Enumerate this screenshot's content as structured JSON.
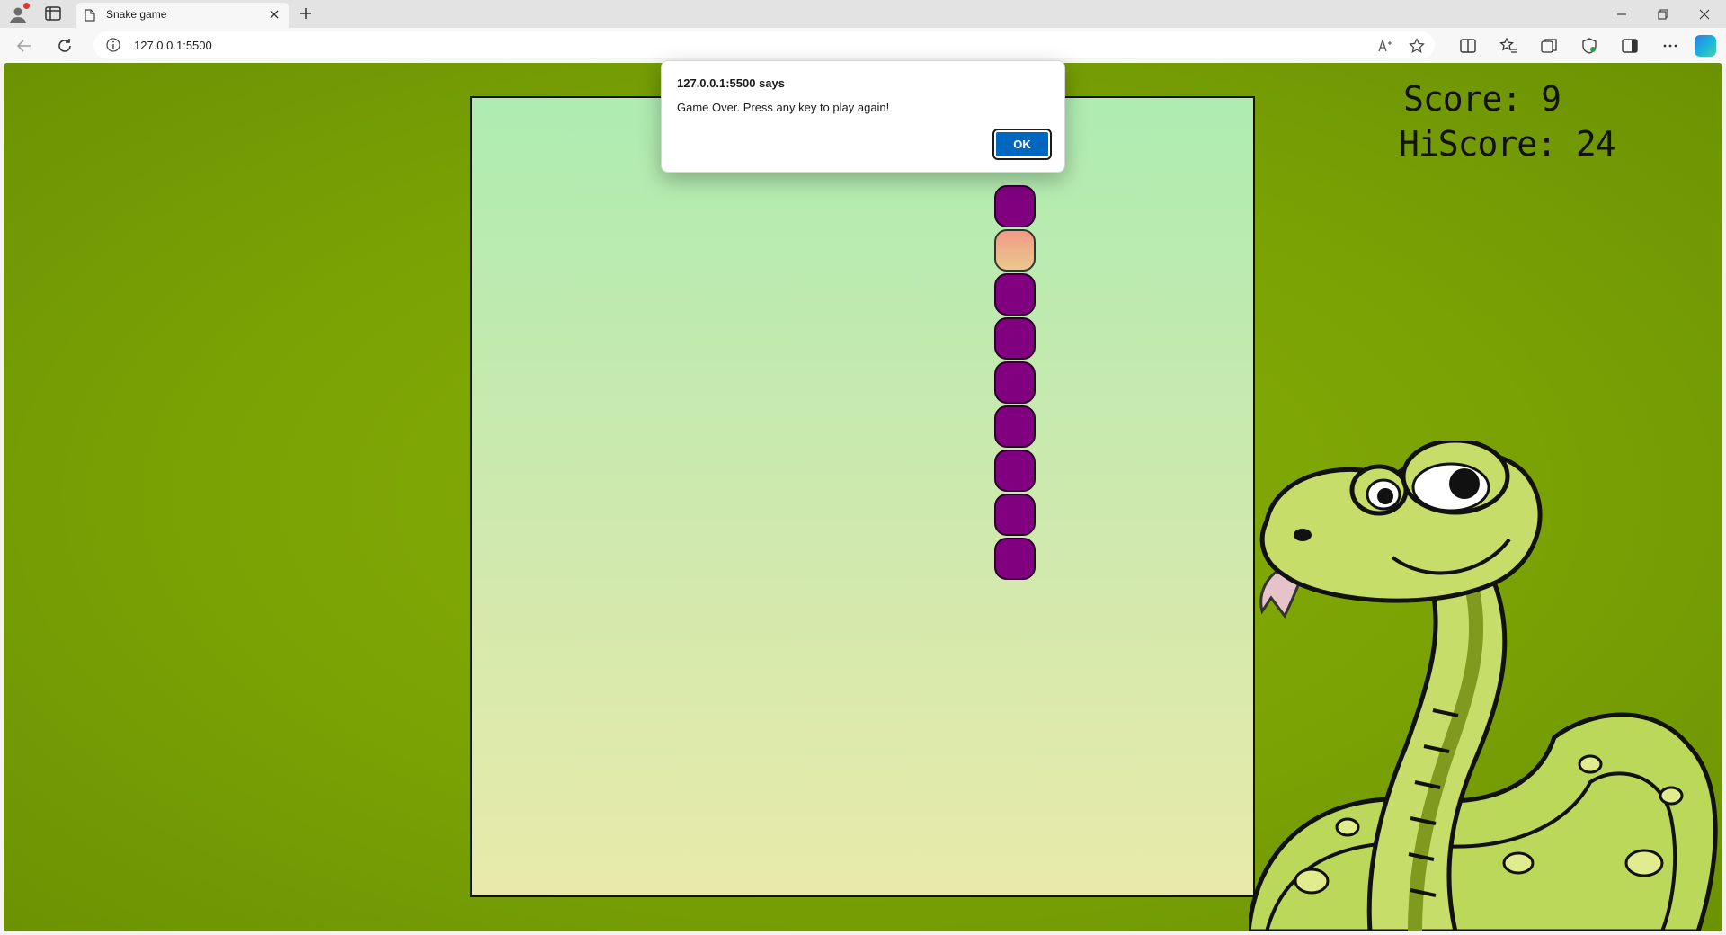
{
  "browser": {
    "tab_title": "Snake game",
    "url": "127.0.0.1:5500"
  },
  "game": {
    "score_text": "Score: 9",
    "hiscore_text": "HiScore: 24",
    "score": 9,
    "hiscore": 24,
    "snake_color": "#800080",
    "food_color": "#f29a86"
  },
  "dialog": {
    "title": "127.0.0.1:5500 says",
    "message": "Game Over. Press any key to play again!",
    "ok_label": "OK"
  },
  "colors": {
    "page_background": "#7aa204",
    "board_top": "#aeecb1",
    "board_bottom": "#e8eaaa",
    "dialog_button": "#0067c0"
  }
}
